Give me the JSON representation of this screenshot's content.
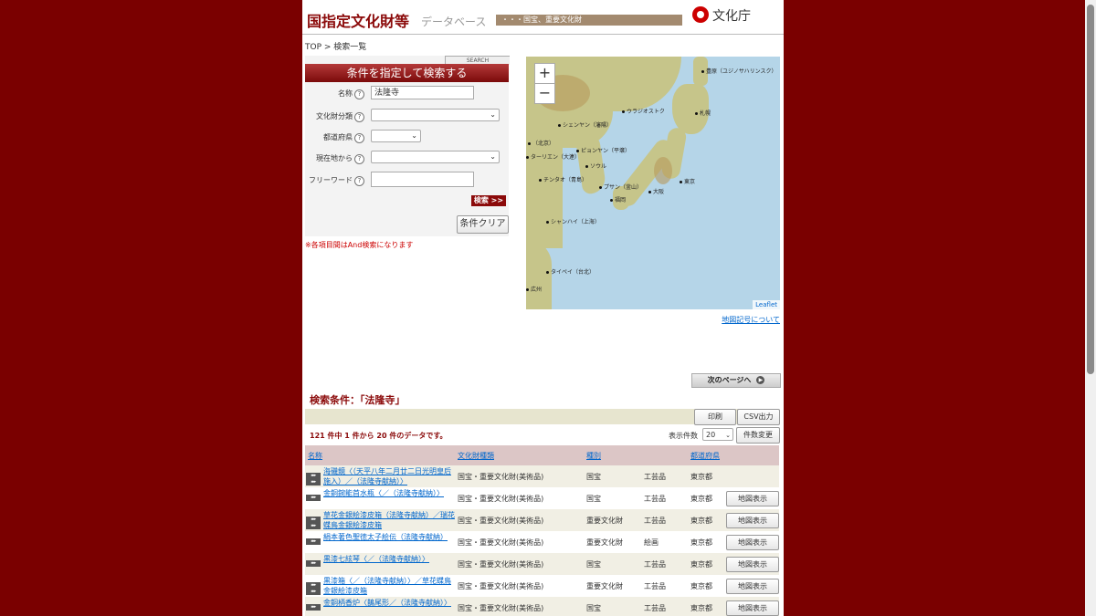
{
  "header": {
    "title": "国指定文化財等",
    "subtitle": "データベース",
    "category_bar": "・・・国宝、重要文化財",
    "agency_logo_text": "文化庁"
  },
  "breadcrumb": {
    "top": "TOP",
    "sep": " > ",
    "current": "検索一覧"
  },
  "search": {
    "tab_label": "SEARCH",
    "heading": "条件を指定して検索する",
    "fields": {
      "name_label": "名称",
      "name_value": "法隆寺",
      "category_label": "文化財分類",
      "prefecture_label": "都道府県",
      "location_label": "現在地から",
      "freeword_label": "フリーワード"
    },
    "help_glyph": "?",
    "search_button": "検索 >>",
    "clear_button": "条件クリア",
    "note": "※各項目間はAnd検索になります"
  },
  "map": {
    "zoom_in": "+",
    "zoom_out": "−",
    "attribution": "Leaflet",
    "legend_link": "地図記号について",
    "cities": [
      "豊原（ユジノサハリンスク）",
      "ウラジオストク",
      "札幌",
      "シェンヤン（瀋陽）",
      "（北京）",
      "ピョンヤン（平壌）",
      "ターリエン（大連）",
      "ソウル",
      "チンタオ（青島）",
      "プサン（釜山）",
      "福岡",
      "大阪",
      "東京",
      "シャンハイ（上海）",
      "タイペイ（台北）",
      "広州"
    ]
  },
  "results": {
    "next_page": "次のページへ",
    "next_glyph": "▶",
    "condition": "検索条件：「法隆寺」",
    "print_button": "印刷",
    "csv_button": "CSV出力",
    "count_text": "121 件中 1 件から 20 件のデータです。",
    "per_page_label": "表示件数",
    "per_page_value": "20",
    "per_page_button": "件数変更",
    "columns": {
      "name": "名称",
      "type": "文化財種類",
      "class": "種別",
      "prefecture": "都道府県"
    },
    "map_button": "地図表示",
    "arrow_glyph": "▸▸▸",
    "rows": [
      {
        "name": "海磯鏡〈（天平八年二月廿二日光明皇后施入）／（法隆寺献納）〉",
        "type": "国宝・重要文化財(美術品)",
        "class": "国宝",
        "sub": "工芸品",
        "pref": "東京都",
        "double": true
      },
      {
        "name": "金銅鋺能首水瓶〈／（法隆寺献納）〉",
        "type": "国宝・重要文化財(美術品)",
        "class": "国宝",
        "sub": "工芸品",
        "pref": "東京都",
        "double": false
      },
      {
        "name": "草花金銀絵漆皮箱（法隆寺献納）／瑞花蝶鳥金銀絵漆皮箱",
        "type": "国宝・重要文化財(美術品)",
        "class": "重要文化財",
        "sub": "工芸品",
        "pref": "東京都",
        "double": true
      },
      {
        "name": "絹本著色聖徳太子絵伝（法隆寺献納）",
        "type": "国宝・重要文化財(美術品)",
        "class": "重要文化財",
        "sub": "絵画",
        "pref": "東京都",
        "double": false
      },
      {
        "name": "黒漆七絃琴〈／（法隆寺献納）〉",
        "type": "国宝・重要文化財(美術品)",
        "class": "国宝",
        "sub": "工芸品",
        "pref": "東京都",
        "double": false
      },
      {
        "name": "黒漆箱〈／（法隆寺献納）〉／草花蝶鳥金銀絵漆皮箱",
        "type": "国宝・重要文化財(美術品)",
        "class": "重要文化財",
        "sub": "工芸品",
        "pref": "東京都",
        "double": true
      },
      {
        "name": "金銅柄香炉〈鵲尾形／（法隆寺献納）〉",
        "type": "国宝・重要文化財(美術品)",
        "class": "国宝",
        "sub": "工芸品",
        "pref": "東京都",
        "double": false
      }
    ]
  },
  "colors": {
    "background": "#7a0000",
    "accent": "#8b0a0a",
    "link": "#0066cc"
  }
}
